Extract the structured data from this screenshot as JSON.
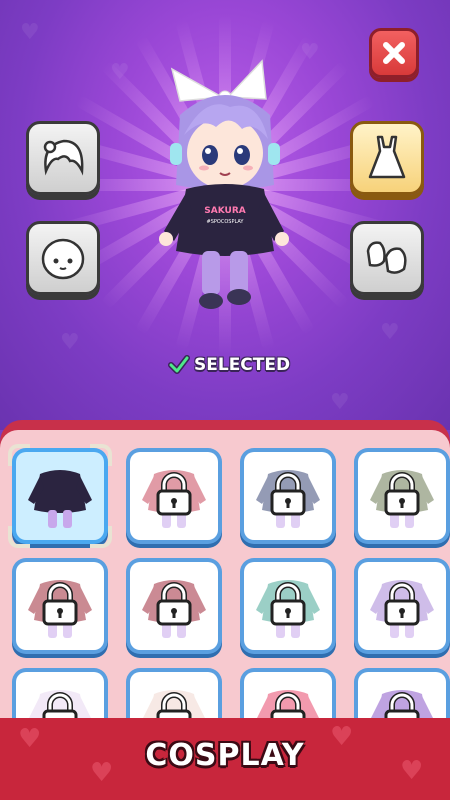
{
  "status": {
    "selected_label": "SELECTED"
  },
  "bottom_bar": {
    "title": "COSPLAY"
  },
  "character": {
    "shirt_line1": "SAKURA",
    "shirt_line2": "#SPOCOSPLAY"
  },
  "categories": [
    {
      "name": "hair",
      "icon": "hair-icon",
      "active": false
    },
    {
      "name": "face",
      "icon": "face-icon",
      "active": false
    },
    {
      "name": "outfit",
      "icon": "dress-icon",
      "active": true
    },
    {
      "name": "shoes",
      "icon": "shoes-icon",
      "active": false
    }
  ],
  "outfits": [
    {
      "color": "#2b2440",
      "locked": false,
      "selected": true
    },
    {
      "color": "#c84a5e",
      "locked": true,
      "selected": false
    },
    {
      "color": "#3c4a78",
      "locked": true,
      "selected": false
    },
    {
      "color": "#6c7a54",
      "locked": true,
      "selected": false
    },
    {
      "color": "#9e2a3a",
      "locked": true,
      "selected": false
    },
    {
      "color": "#a02a3c",
      "locked": true,
      "selected": false
    },
    {
      "color": "#4aa898",
      "locked": true,
      "selected": false
    },
    {
      "color": "#a888d8",
      "locked": true,
      "selected": false
    },
    {
      "color": "#e8d8f0",
      "locked": true,
      "selected": false
    },
    {
      "color": "#f0d8d0",
      "locked": true,
      "selected": false
    },
    {
      "color": "#e8486c",
      "locked": true,
      "selected": false
    },
    {
      "color": "#8a58c8",
      "locked": true,
      "selected": false
    }
  ],
  "colors": {
    "accent": "#c8263c",
    "panel": "#f7c9cf",
    "card_border": "#5a9fe0",
    "close": "#e84848"
  }
}
